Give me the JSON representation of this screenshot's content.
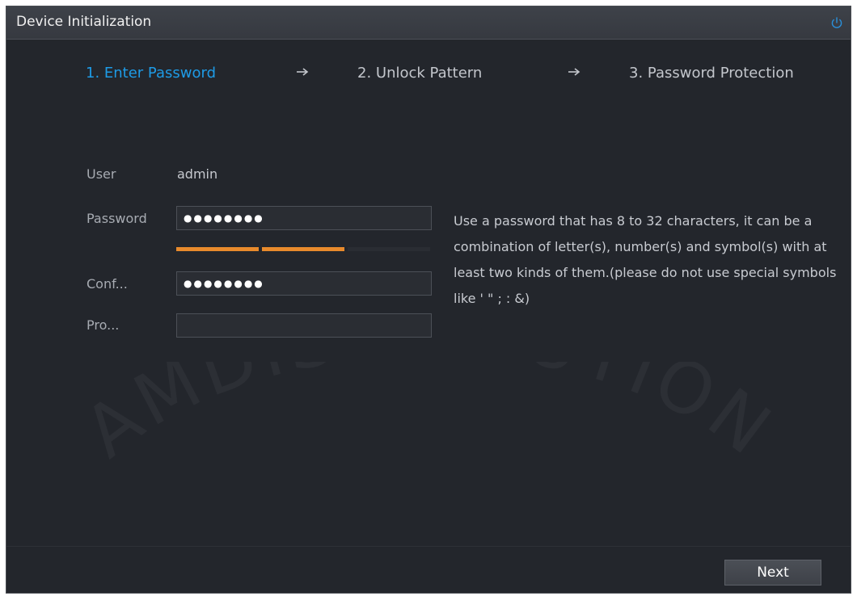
{
  "window": {
    "title": "Device Initialization"
  },
  "steps": [
    {
      "label": "1. Enter Password",
      "active": true
    },
    {
      "label": "2. Unlock Pattern",
      "active": false
    },
    {
      "label": "3. Password Protection",
      "active": false
    }
  ],
  "form": {
    "user_label": "User",
    "user_value": "admin",
    "password_label": "Password",
    "password_value": "●●●●●●●●",
    "confirm_label": "Conf...",
    "confirm_value": "●●●●●●●●",
    "prompt_label": "Pro...",
    "prompt_value": "",
    "strength_level": 0.66,
    "hint": "Use a password that has 8 to 32 characters, it can be a combination of letter(s), number(s) and symbol(s) with at least two kinds of them.(please do not use special symbols like ' \" ; : &)"
  },
  "buttons": {
    "next_label": "Next"
  },
  "colors": {
    "background": "#23262c",
    "accent": "#1e9be6",
    "strength_bar": "#e88a2c",
    "inactive_step": "#c3c6cc"
  },
  "icons": {
    "power": "power-icon",
    "step_arrow": "right-arrow-icon"
  },
  "watermark": {
    "text": "AMDISTRIBUTION"
  }
}
